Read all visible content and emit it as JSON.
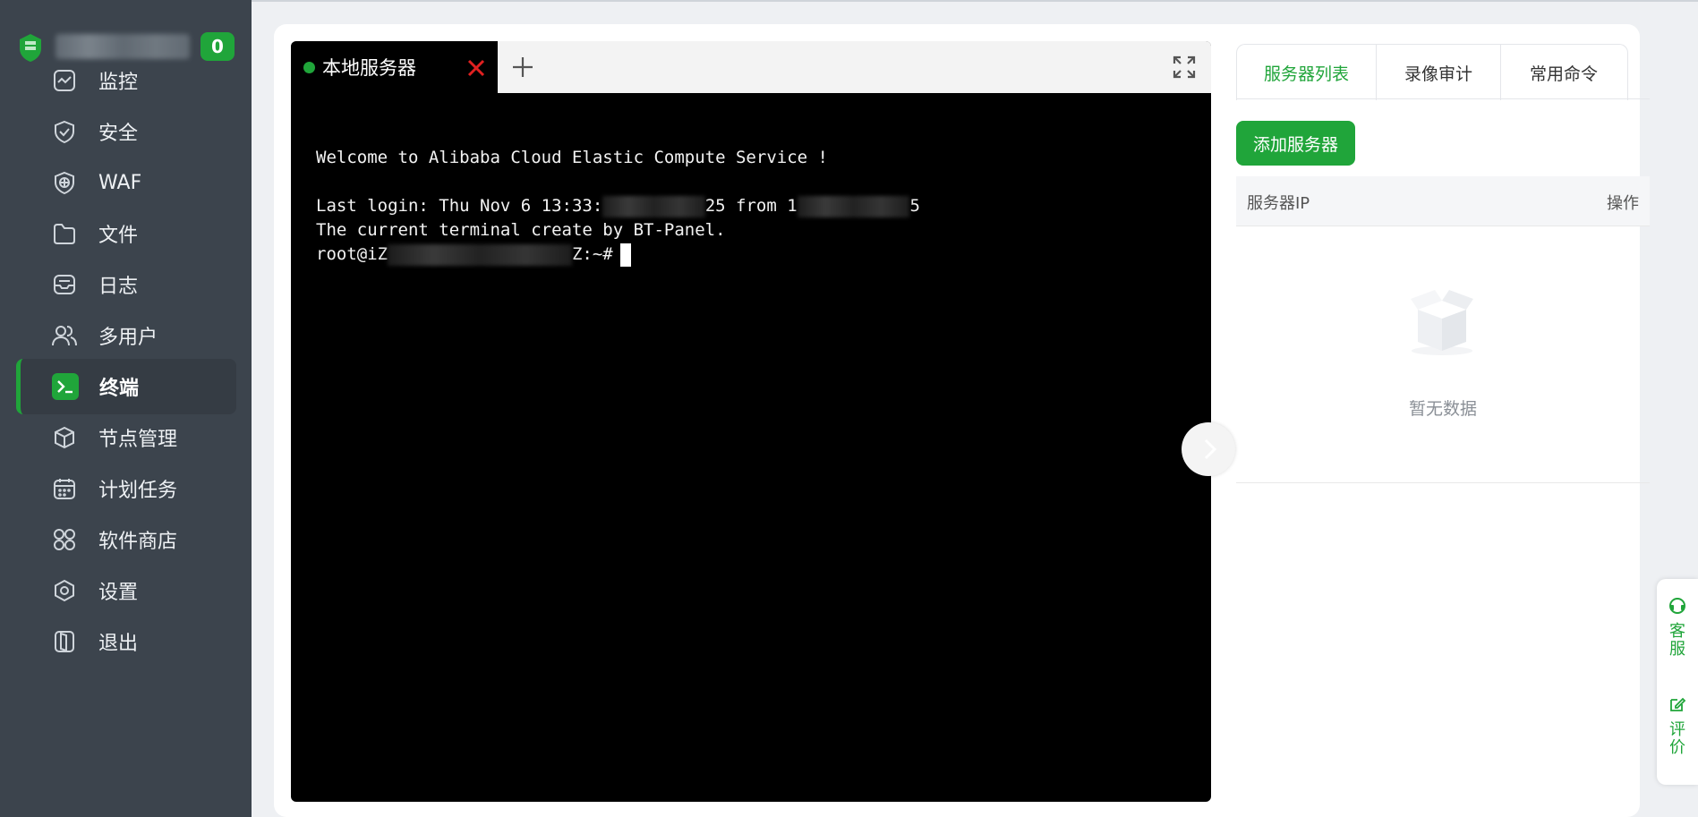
{
  "sidebar": {
    "badge_count": "0",
    "items": [
      {
        "label": "监控",
        "icon": "monitor-icon"
      },
      {
        "label": "安全",
        "icon": "shield-check-icon"
      },
      {
        "label": "WAF",
        "icon": "waf-globe-shield-icon"
      },
      {
        "label": "文件",
        "icon": "folder-icon"
      },
      {
        "label": "日志",
        "icon": "log-tray-icon"
      },
      {
        "label": "多用户",
        "icon": "users-icon"
      },
      {
        "label": "终端",
        "icon": "terminal-icon",
        "active": true
      },
      {
        "label": "节点管理",
        "icon": "cube-icon"
      },
      {
        "label": "计划任务",
        "icon": "calendar-icon"
      },
      {
        "label": "软件商店",
        "icon": "apps-icon"
      },
      {
        "label": "设置",
        "icon": "settings-icon"
      },
      {
        "label": "退出",
        "icon": "logout-icon"
      }
    ]
  },
  "terminal": {
    "tab_label": "本地服务器",
    "lines": {
      "welcome": "Welcome to Alibaba Cloud Elastic Compute Service !",
      "login_prefix": "Last login: Thu Nov 6 13:33:",
      "login_mid": "25 from 1",
      "login_end": "5",
      "created_by": "The current terminal create by BT-Panel.",
      "prompt_prefix": "root@iZ",
      "prompt_suffix": "Z:~#"
    }
  },
  "panel": {
    "tabs": [
      "服务器列表",
      "录像审计",
      "常用命令"
    ],
    "active_tab": "服务器列表",
    "add_button": "添加服务器",
    "columns": [
      "服务器IP",
      "操作"
    ],
    "empty_text": "暂无数据"
  },
  "float_widget": {
    "support_label": "客服",
    "review_label": "评价"
  },
  "colors": {
    "accent": "#20a53a",
    "sidebar_bg": "#3c444d",
    "terminal_bg": "#000000"
  }
}
